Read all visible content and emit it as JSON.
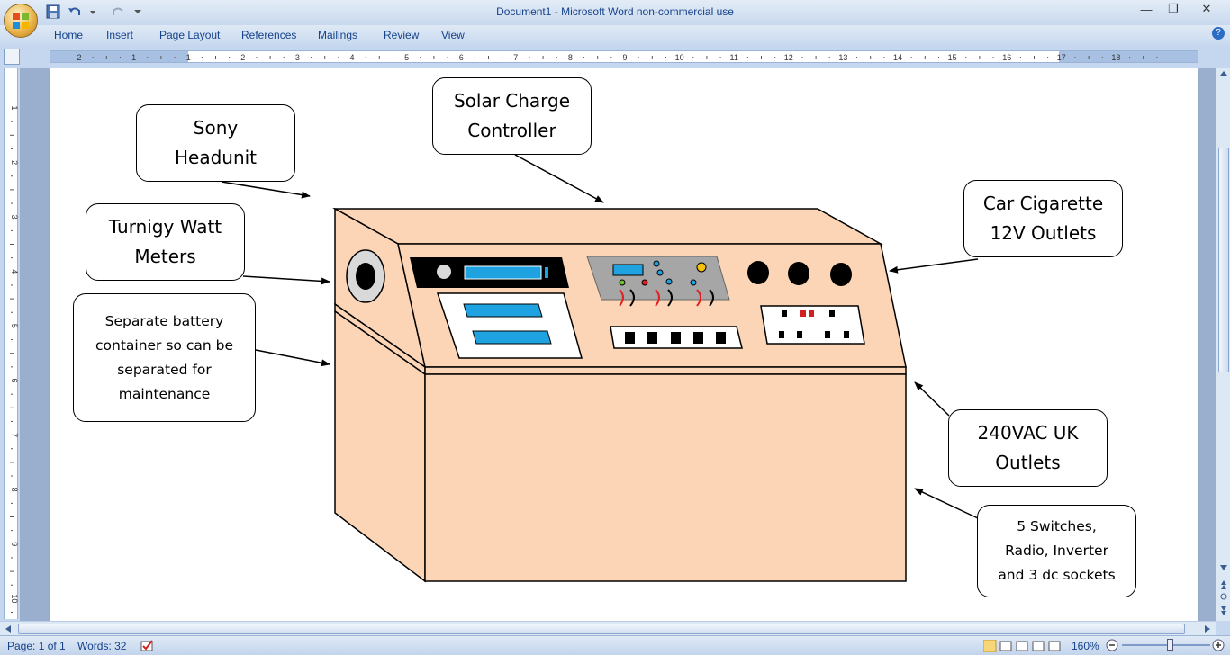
{
  "window": {
    "title": "Document1 - Microsoft Word non-commercial use",
    "controls": [
      "minimize",
      "restore",
      "close"
    ]
  },
  "ribbon": {
    "tabs": [
      "Home",
      "Insert",
      "Page Layout",
      "References",
      "Mailings",
      "Review",
      "View"
    ]
  },
  "ruler": {
    "numbers": [
      "2",
      "1",
      "1",
      "2",
      "3",
      "4",
      "5",
      "6",
      "7",
      "8",
      "9",
      "10",
      "11",
      "12",
      "13",
      "14",
      "15",
      "16",
      "17",
      "18"
    ],
    "vertical_numbers": [
      "1",
      "2",
      "3",
      "4",
      "5",
      "6",
      "7",
      "8",
      "9",
      "10",
      "11"
    ]
  },
  "document": {
    "callouts": {
      "sony": "Sony Headunit",
      "solar": "Solar Charge Controller",
      "watt": "Turnigy Watt Meters",
      "cigarette": "Car Cigarette 12V Outlets",
      "battery": "Separate battery container so can be separated for maintenance",
      "ac": "240VAC UK Outlets",
      "switches": "5 Switches, Radio, Inverter and 3 dc sockets"
    },
    "colors": {
      "cabinet": "#fbd5b5",
      "display_blue": "#1fa3e0",
      "panel_grey": "#a6a6a6"
    }
  },
  "status": {
    "page": "Page: 1 of 1",
    "words": "Words: 32",
    "zoom": "160%"
  }
}
